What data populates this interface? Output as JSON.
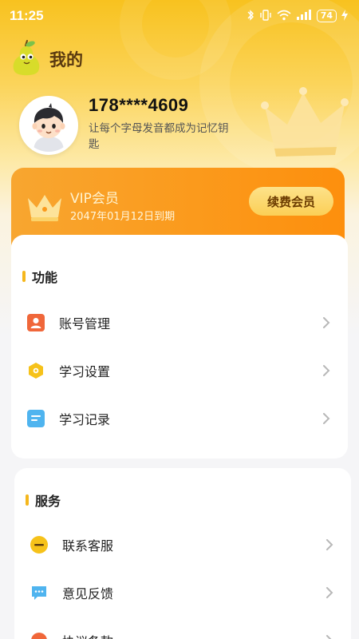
{
  "status_bar": {
    "time": "11:25",
    "icons": [
      "bluetooth-icon",
      "vibrate-icon",
      "wifi-icon",
      "signal-icon"
    ],
    "battery": "74"
  },
  "header": {
    "title": "我的"
  },
  "profile": {
    "phone": "178****4609",
    "motto": "让每个字母发音都成为记忆钥匙"
  },
  "vip": {
    "title": "VIP会员",
    "expire": "2047年01月12日到期",
    "renew_label": "续费会员"
  },
  "functions": {
    "title": "功能",
    "items": [
      {
        "label": "账号管理",
        "icon": "account-icon"
      },
      {
        "label": "学习设置",
        "icon": "settings-icon"
      },
      {
        "label": "学习记录",
        "icon": "record-icon"
      }
    ]
  },
  "services": {
    "title": "服务",
    "items": [
      {
        "label": "联系客服",
        "icon": "customer-service-icon"
      },
      {
        "label": "意见反馈",
        "icon": "feedback-icon"
      },
      {
        "label": "协议条款",
        "icon": "agreement-icon"
      }
    ]
  },
  "colors": {
    "primary_yellow": "#f8c21f",
    "vip_orange": "#fb9a1c",
    "accent_bar": "#f5b71c"
  }
}
